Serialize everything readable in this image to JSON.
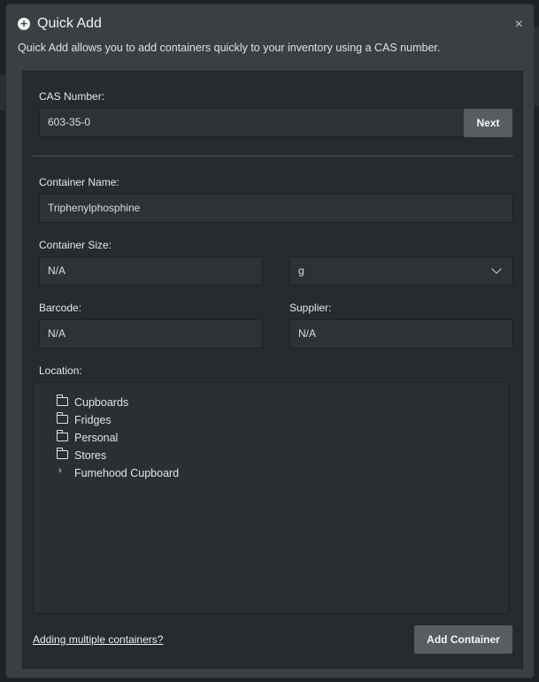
{
  "modal": {
    "title": "Quick Add",
    "description": "Quick Add allows you to add containers quickly to your inventory using a CAS number.",
    "close_glyph": "×"
  },
  "icons": {
    "title": "plus-circle-icon",
    "close": "close-icon",
    "folder": "folder-icon",
    "expand": "chevron-right-icon",
    "dropdown": "chevron-down-icon"
  },
  "cas": {
    "label": "CAS Number:",
    "value": "603-35-0",
    "next_label": "Next"
  },
  "container_name": {
    "label": "Container Name:",
    "value": "Triphenylphosphine"
  },
  "container_size": {
    "label": "Container Size:",
    "value": "N/A",
    "unit": "g"
  },
  "barcode": {
    "label": "Barcode:",
    "value": "N/A"
  },
  "supplier": {
    "label": "Supplier:",
    "value": "N/A"
  },
  "location": {
    "label": "Location:",
    "items": [
      {
        "label": "Cupboards",
        "icon": "folder"
      },
      {
        "label": "Fridges",
        "icon": "folder"
      },
      {
        "label": "Personal",
        "icon": "folder"
      },
      {
        "label": "Stores",
        "icon": "folder"
      },
      {
        "label": "Fumehood Cupboard",
        "icon": "expand",
        "glyph": "›"
      }
    ]
  },
  "footer": {
    "multiple_link": "Adding multiple containers?",
    "add_label": "Add Container"
  },
  "colors": {
    "modal_bg": "#3a3f42",
    "panel_bg": "#272b2e",
    "button_bg": "#565e63"
  }
}
